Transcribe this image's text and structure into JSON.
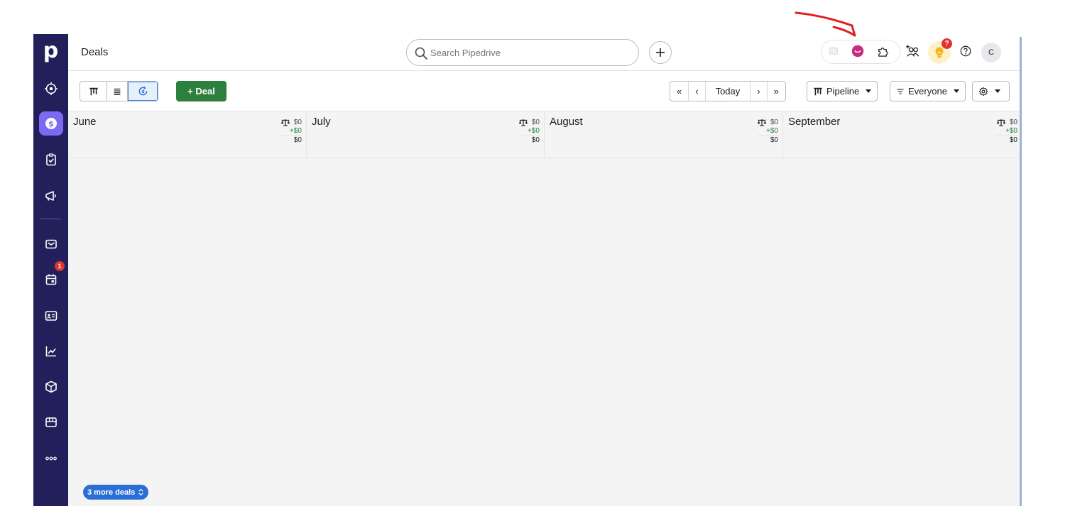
{
  "app": {
    "logo_text": "p",
    "page_title": "Deals"
  },
  "search": {
    "placeholder": "Search Pipedrive"
  },
  "sidebar": {
    "items": [
      {
        "icon": "target-icon"
      },
      {
        "icon": "dollar-icon",
        "active": true
      },
      {
        "icon": "clipboard-check-icon"
      },
      {
        "icon": "megaphone-icon"
      },
      {
        "icon": "mail-icon"
      },
      {
        "icon": "calendar-icon",
        "badge": "1"
      },
      {
        "icon": "contact-card-icon"
      },
      {
        "icon": "chart-line-icon"
      },
      {
        "icon": "box-icon"
      },
      {
        "icon": "store-icon"
      },
      {
        "icon": "more-icon"
      }
    ]
  },
  "header_icons": {
    "bulb_badge": "?",
    "avatar_initial": "C"
  },
  "toolbar": {
    "deal_button": "+ Deal",
    "period": {
      "first": "«",
      "prev": "‹",
      "today": "Today",
      "next": "›",
      "last": "»"
    },
    "pipeline_label": "Pipeline",
    "filter_label": "Everyone"
  },
  "columns": [
    {
      "name": "June",
      "weighted": "$0",
      "added": "+$0",
      "total": "$0"
    },
    {
      "name": "July",
      "weighted": "$0",
      "added": "+$0",
      "total": "$0"
    },
    {
      "name": "August",
      "weighted": "$0",
      "added": "+$0",
      "total": "$0"
    },
    {
      "name": "September",
      "weighted": "$0",
      "added": "+$0",
      "total": "$0"
    }
  ],
  "more_deals": {
    "label": "3 more deals"
  },
  "colors": {
    "sidebar_bg": "#21205a",
    "active_nav": "#7c6af4",
    "deal_green": "#2c7f3d",
    "badge_red": "#e0332d",
    "more_deals_blue": "#2b6fd6",
    "annotation_red": "#e02020"
  }
}
